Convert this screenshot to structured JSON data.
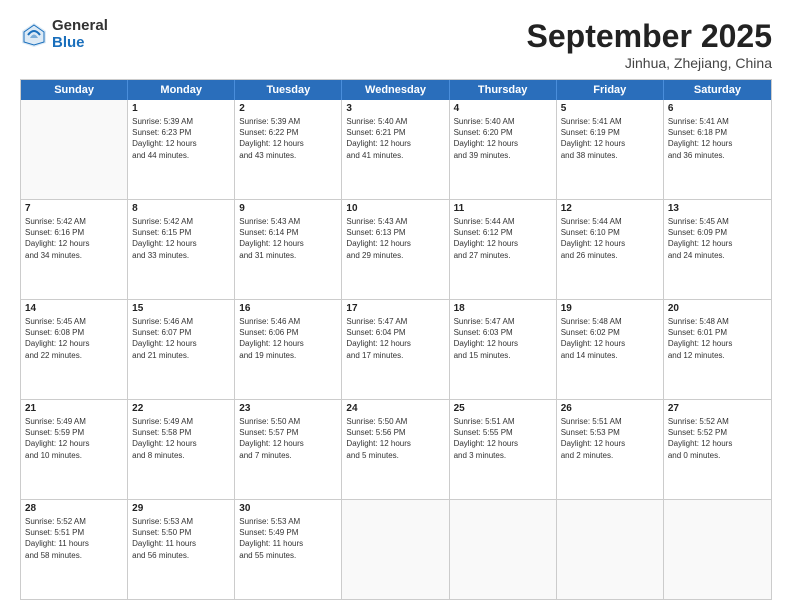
{
  "header": {
    "logo_general": "General",
    "logo_blue": "Blue",
    "month": "September 2025",
    "location": "Jinhua, Zhejiang, China"
  },
  "weekdays": [
    "Sunday",
    "Monday",
    "Tuesday",
    "Wednesday",
    "Thursday",
    "Friday",
    "Saturday"
  ],
  "rows": [
    [
      {
        "day": "",
        "text": ""
      },
      {
        "day": "1",
        "text": "Sunrise: 5:39 AM\nSunset: 6:23 PM\nDaylight: 12 hours\nand 44 minutes."
      },
      {
        "day": "2",
        "text": "Sunrise: 5:39 AM\nSunset: 6:22 PM\nDaylight: 12 hours\nand 43 minutes."
      },
      {
        "day": "3",
        "text": "Sunrise: 5:40 AM\nSunset: 6:21 PM\nDaylight: 12 hours\nand 41 minutes."
      },
      {
        "day": "4",
        "text": "Sunrise: 5:40 AM\nSunset: 6:20 PM\nDaylight: 12 hours\nand 39 minutes."
      },
      {
        "day": "5",
        "text": "Sunrise: 5:41 AM\nSunset: 6:19 PM\nDaylight: 12 hours\nand 38 minutes."
      },
      {
        "day": "6",
        "text": "Sunrise: 5:41 AM\nSunset: 6:18 PM\nDaylight: 12 hours\nand 36 minutes."
      }
    ],
    [
      {
        "day": "7",
        "text": "Sunrise: 5:42 AM\nSunset: 6:16 PM\nDaylight: 12 hours\nand 34 minutes."
      },
      {
        "day": "8",
        "text": "Sunrise: 5:42 AM\nSunset: 6:15 PM\nDaylight: 12 hours\nand 33 minutes."
      },
      {
        "day": "9",
        "text": "Sunrise: 5:43 AM\nSunset: 6:14 PM\nDaylight: 12 hours\nand 31 minutes."
      },
      {
        "day": "10",
        "text": "Sunrise: 5:43 AM\nSunset: 6:13 PM\nDaylight: 12 hours\nand 29 minutes."
      },
      {
        "day": "11",
        "text": "Sunrise: 5:44 AM\nSunset: 6:12 PM\nDaylight: 12 hours\nand 27 minutes."
      },
      {
        "day": "12",
        "text": "Sunrise: 5:44 AM\nSunset: 6:10 PM\nDaylight: 12 hours\nand 26 minutes."
      },
      {
        "day": "13",
        "text": "Sunrise: 5:45 AM\nSunset: 6:09 PM\nDaylight: 12 hours\nand 24 minutes."
      }
    ],
    [
      {
        "day": "14",
        "text": "Sunrise: 5:45 AM\nSunset: 6:08 PM\nDaylight: 12 hours\nand 22 minutes."
      },
      {
        "day": "15",
        "text": "Sunrise: 5:46 AM\nSunset: 6:07 PM\nDaylight: 12 hours\nand 21 minutes."
      },
      {
        "day": "16",
        "text": "Sunrise: 5:46 AM\nSunset: 6:06 PM\nDaylight: 12 hours\nand 19 minutes."
      },
      {
        "day": "17",
        "text": "Sunrise: 5:47 AM\nSunset: 6:04 PM\nDaylight: 12 hours\nand 17 minutes."
      },
      {
        "day": "18",
        "text": "Sunrise: 5:47 AM\nSunset: 6:03 PM\nDaylight: 12 hours\nand 15 minutes."
      },
      {
        "day": "19",
        "text": "Sunrise: 5:48 AM\nSunset: 6:02 PM\nDaylight: 12 hours\nand 14 minutes."
      },
      {
        "day": "20",
        "text": "Sunrise: 5:48 AM\nSunset: 6:01 PM\nDaylight: 12 hours\nand 12 minutes."
      }
    ],
    [
      {
        "day": "21",
        "text": "Sunrise: 5:49 AM\nSunset: 5:59 PM\nDaylight: 12 hours\nand 10 minutes."
      },
      {
        "day": "22",
        "text": "Sunrise: 5:49 AM\nSunset: 5:58 PM\nDaylight: 12 hours\nand 8 minutes."
      },
      {
        "day": "23",
        "text": "Sunrise: 5:50 AM\nSunset: 5:57 PM\nDaylight: 12 hours\nand 7 minutes."
      },
      {
        "day": "24",
        "text": "Sunrise: 5:50 AM\nSunset: 5:56 PM\nDaylight: 12 hours\nand 5 minutes."
      },
      {
        "day": "25",
        "text": "Sunrise: 5:51 AM\nSunset: 5:55 PM\nDaylight: 12 hours\nand 3 minutes."
      },
      {
        "day": "26",
        "text": "Sunrise: 5:51 AM\nSunset: 5:53 PM\nDaylight: 12 hours\nand 2 minutes."
      },
      {
        "day": "27",
        "text": "Sunrise: 5:52 AM\nSunset: 5:52 PM\nDaylight: 12 hours\nand 0 minutes."
      }
    ],
    [
      {
        "day": "28",
        "text": "Sunrise: 5:52 AM\nSunset: 5:51 PM\nDaylight: 11 hours\nand 58 minutes."
      },
      {
        "day": "29",
        "text": "Sunrise: 5:53 AM\nSunset: 5:50 PM\nDaylight: 11 hours\nand 56 minutes."
      },
      {
        "day": "30",
        "text": "Sunrise: 5:53 AM\nSunset: 5:49 PM\nDaylight: 11 hours\nand 55 minutes."
      },
      {
        "day": "",
        "text": ""
      },
      {
        "day": "",
        "text": ""
      },
      {
        "day": "",
        "text": ""
      },
      {
        "day": "",
        "text": ""
      }
    ]
  ]
}
